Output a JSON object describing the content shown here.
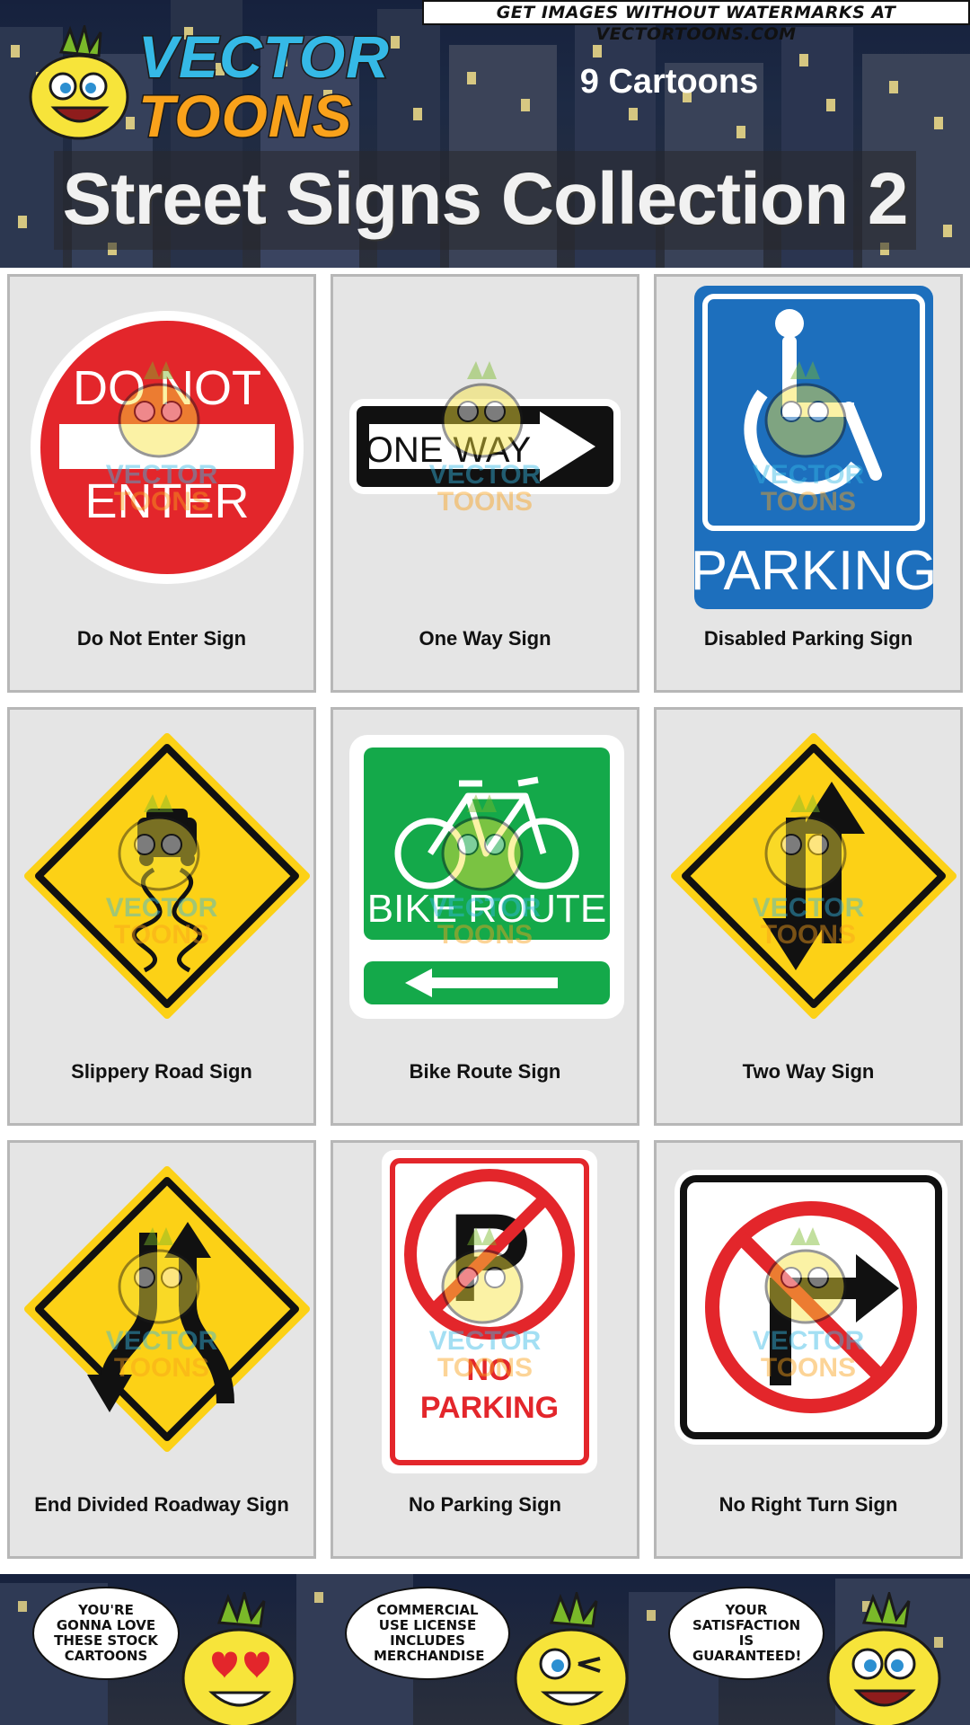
{
  "header": {
    "watermark_banner": "GET IMAGES WITHOUT WATERMARKS AT VECTORTOONS.COM",
    "logo_top": "VECTOR",
    "logo_bottom": "TOONS",
    "count": "9 Cartoons",
    "title": "Street Signs Collection 2"
  },
  "cards": [
    {
      "label": "Do Not Enter Sign",
      "icon": "do-not-enter-sign-icon",
      "sign_text": [
        "DO NOT",
        "ENTER"
      ]
    },
    {
      "label": "One Way Sign",
      "icon": "one-way-sign-icon",
      "sign_text": [
        "ONE WAY"
      ]
    },
    {
      "label": "Disabled Parking Sign",
      "icon": "disabled-parking-sign-icon",
      "sign_text": [
        "PARKING"
      ]
    },
    {
      "label": "Slippery Road Sign",
      "icon": "slippery-road-sign-icon"
    },
    {
      "label": "Bike Route Sign",
      "icon": "bike-route-sign-icon",
      "sign_text": [
        "BIKE ROUTE"
      ]
    },
    {
      "label": "Two Way Sign",
      "icon": "two-way-sign-icon"
    },
    {
      "label": "End Divided Roadway Sign",
      "icon": "end-divided-roadway-sign-icon"
    },
    {
      "label": "No Parking Sign",
      "icon": "no-parking-sign-icon",
      "sign_text": [
        "P",
        "NO",
        "PARKING"
      ]
    },
    {
      "label": "No Right Turn Sign",
      "icon": "no-right-turn-sign-icon"
    }
  ],
  "watermark": {
    "logo_top": "VECTOR",
    "logo_bottom": "TOONS"
  },
  "footer": {
    "bubbles": [
      "YOU'RE GONNA LOVE THESE STOCK CARTOONS",
      "COMMERCIAL USE LICENSE INCLUDES MERCHANDISE",
      "YOUR SATISFACTION IS GUARANTEED!"
    ]
  },
  "colors": {
    "sign_red": "#e3262b",
    "sign_yellow": "#fcd116",
    "sign_blue": "#1d6fbd",
    "sign_green": "#14a94a",
    "card_bg": "#e5e5e5",
    "logo_blue": "#35b9e6",
    "logo_orange": "#f9a21b"
  }
}
